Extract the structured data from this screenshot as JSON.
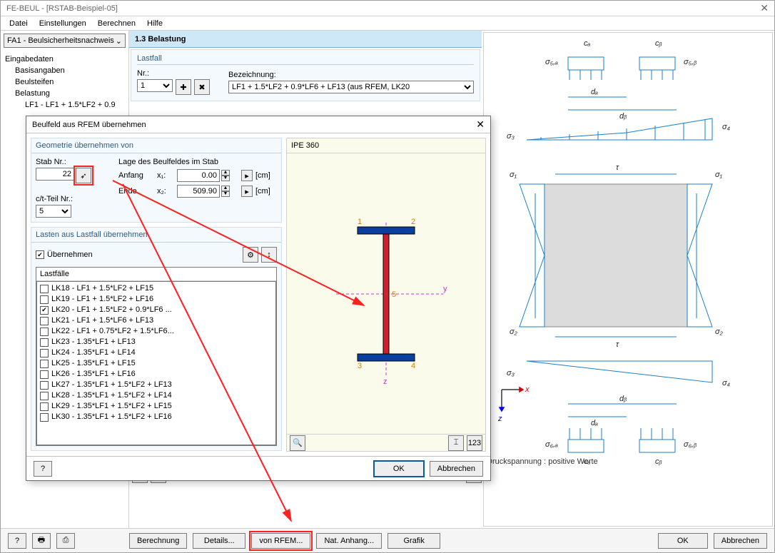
{
  "window": {
    "title": "FE-BEUL - [RSTAB-Beispiel-05]",
    "close": "✕"
  },
  "menu": {
    "items": [
      "Datei",
      "Einstellungen",
      "Berechnen",
      "Hilfe"
    ]
  },
  "sidebar": {
    "combo": "FA1 - Beulsicherheitsnachweis",
    "tree": {
      "root": "Eingabedaten",
      "n1": "Basisangaben",
      "n2": "Beulsteifen",
      "n3": "Belastung",
      "n4": "LF1 - LF1 + 1.5*LF2 + 0.9"
    }
  },
  "tab": {
    "title": "1.3 Belastung"
  },
  "lastfall": {
    "group": "Lastfall",
    "nr_label": "Nr.:",
    "nr_value": "1",
    "bez_label": "Bezeichnung:",
    "bez_value": "LF1 + 1.5*LF2 + 0.9*LF6 + LF13 (aus RFEM, LK20"
  },
  "dialog": {
    "title": "Beulfeld aus RFEM übernehmen",
    "close": "✕",
    "geom": {
      "group": "Geometrie übernehmen von",
      "stab_label": "Stab Nr.:",
      "stab_value": "22",
      "lage_label": "Lage des Beulfeldes im Stab",
      "anfang": "Anfang",
      "ende": "Ende",
      "x1": "x₁:",
      "x1_val": "0.00",
      "x2": "x₂:",
      "x2_val": "509.90",
      "unit": "[cm]",
      "ct_label": "c/t-Teil Nr.:",
      "ct_value": "5"
    },
    "lasten": {
      "group": "Lasten aus Lastfall übernehmen",
      "uebernehmen": "Übernehmen",
      "lfheader": "Lastfälle",
      "items": [
        {
          "label": "LK18 - LF1 + 1.5*LF2 + LF15",
          "checked": false
        },
        {
          "label": "LK19 - LF1 + 1.5*LF2 + LF16",
          "checked": false
        },
        {
          "label": "LK20 - LF1 + 1.5*LF2 + 0.9*LF6 ...",
          "checked": true
        },
        {
          "label": "LK21 - LF1 + 1.5*LF6 + LF13",
          "checked": false
        },
        {
          "label": "LK22 - LF1 + 0.75*LF2 + 1.5*LF6...",
          "checked": false
        },
        {
          "label": "LK23 - 1.35*LF1 + LF13",
          "checked": false
        },
        {
          "label": "LK24 - 1.35*LF1 + LF14",
          "checked": false
        },
        {
          "label": "LK25 - 1.35*LF1 + LF15",
          "checked": false
        },
        {
          "label": "LK26 - 1.35*LF1 + LF16",
          "checked": false
        },
        {
          "label": "LK27 - 1.35*LF1 + 1.5*LF2 + LF13",
          "checked": false
        },
        {
          "label": "LK28 - 1.35*LF1 + 1.5*LF2 + LF14",
          "checked": false
        },
        {
          "label": "LK29 - 1.35*LF1 + 1.5*LF2 + LF15",
          "checked": false
        },
        {
          "label": "LK30 - 1.35*LF1 + 1.5*LF2 + LF16",
          "checked": false
        }
      ]
    },
    "preview": {
      "title": "IPE 360"
    },
    "ok": "OK",
    "cancel": "Abbrechen"
  },
  "diagram_labels": {
    "s1": "σ₁",
    "s2": "σ₂",
    "s3": "σ₃",
    "s4": "σ₄",
    "s5a": "σ₅,ₐ",
    "s5b": "σ₅,ᵦ",
    "s6a": "σ₆,ₐ",
    "s6b": "σ₆,ᵦ",
    "tau": "τ",
    "ca": "cₐ",
    "cb": "cᵦ",
    "da": "dₐ",
    "db": "dᵦ",
    "x": "x",
    "z": "z",
    "caption": "Druckspannung : positive Werte"
  },
  "bottom": {
    "berechnung": "Berechnung",
    "details": "Details...",
    "vonrfem": "von RFEM...",
    "natanhang": "Nat. Anhang...",
    "grafik": "Grafik",
    "ok": "OK",
    "abbrechen": "Abbrechen"
  }
}
